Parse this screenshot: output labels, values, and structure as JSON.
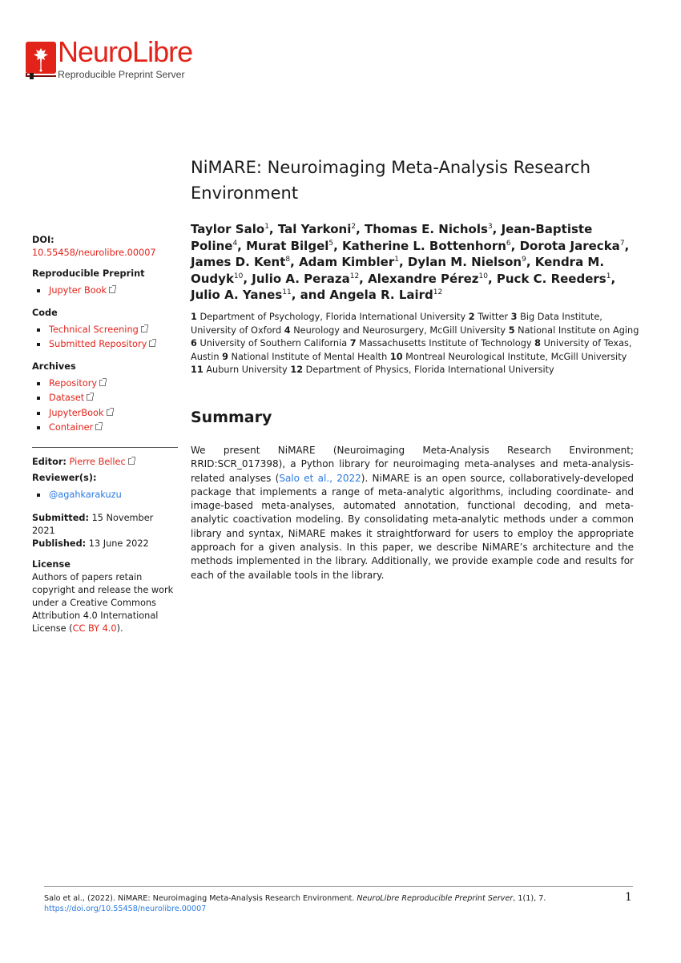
{
  "logo": {
    "name": "NeuroLibre",
    "subtitle": "Reproducible Preprint Server",
    "brand_color": "#e2231a"
  },
  "paper": {
    "title": "NiMARE: Neuroimaging Meta-Analysis Research Environment",
    "authors": [
      {
        "name": "Taylor Salo",
        "aff": "1",
        "sep": ", "
      },
      {
        "name": "Tal Yarkoni",
        "aff": "2",
        "sep": ", "
      },
      {
        "name": "Thomas E. Nichols",
        "aff": "3",
        "sep": ", "
      },
      {
        "name": "Jean-Baptiste Poline",
        "aff": "4",
        "sep": ", "
      },
      {
        "name": "Murat Bilgel",
        "aff": "5",
        "sep": ", "
      },
      {
        "name": "Katherine L. Bottenhorn",
        "aff": "6",
        "sep": ", "
      },
      {
        "name": "Dorota Jarecka",
        "aff": "7",
        "sep": ", "
      },
      {
        "name": "James D. Kent",
        "aff": "8",
        "sep": ", "
      },
      {
        "name": "Adam Kimbler",
        "aff": "1",
        "sep": ", "
      },
      {
        "name": "Dylan M. Nielson",
        "aff": "9",
        "sep": ", "
      },
      {
        "name": "Kendra M. Oudyk",
        "aff": "10",
        "sep": ", "
      },
      {
        "name": "Julio A. Peraza",
        "aff": "12",
        "sep": ", "
      },
      {
        "name": "Alexandre Pérez",
        "aff": "10",
        "sep": ", "
      },
      {
        "name": "Puck C. Reeders",
        "aff": "1",
        "sep": ", "
      },
      {
        "name": "Julio A. Yanes",
        "aff": "11",
        "sep": ", and "
      },
      {
        "name": "Angela R. Laird",
        "aff": "12",
        "sep": ""
      }
    ],
    "affiliations": [
      {
        "num": "1",
        "text": "Department of Psychology, Florida International University"
      },
      {
        "num": "2",
        "text": "Twitter"
      },
      {
        "num": "3",
        "text": "Big Data Institute, University of Oxford"
      },
      {
        "num": "4",
        "text": "Neurology and Neurosurgery, McGill University"
      },
      {
        "num": "5",
        "text": "National Institute on Aging"
      },
      {
        "num": "6",
        "text": "University of Southern California"
      },
      {
        "num": "7",
        "text": "Massachusetts Institute of Technology"
      },
      {
        "num": "8",
        "text": "University of Texas, Austin"
      },
      {
        "num": "9",
        "text": "National Institute of Mental Health"
      },
      {
        "num": "10",
        "text": "Montreal Neurological Institute, McGill University"
      },
      {
        "num": "11",
        "text": "Auburn University"
      },
      {
        "num": "12",
        "text": "Department of Physics, Florida International University"
      }
    ],
    "summary": {
      "heading": "Summary",
      "text_before_cite": "We present NiMARE (Neuroimaging Meta-Analysis Research Environment; RRID:SCR_017398), a Python library for neuroimaging meta-analyses and meta-analysis-related analyses (",
      "citation": "Salo et al., 2022",
      "text_after_cite": ").  NiMARE is an open source, collaboratively-developed package that implements a range of meta-analytic algorithms, including coordinate- and image-based meta-analyses, automated annotation, functional decoding, and meta-analytic coactivation modeling.  By consolidating meta-analytic methods under a common library and syntax, NiMARE makes it straightforward for users to employ the appropriate approach for a given analysis.  In this paper, we describe NiMARE’s architecture and the methods implemented in the library. Additionally, we provide example code and results for each of the available tools in the library."
    }
  },
  "sidebar": {
    "doi_label": "DOI:",
    "doi_value": "10.55458/neurolibre.00007",
    "preprint_heading": "Reproducible Preprint",
    "preprint_links": [
      "Jupyter Book"
    ],
    "code_heading": "Code",
    "code_links": [
      "Technical Screening",
      "Submitted Repository"
    ],
    "archives_heading": "Archives",
    "archives_links": [
      "Repository",
      "Dataset",
      "JupyterBook",
      "Container"
    ],
    "editor_label": "Editor:",
    "editor_name": "Pierre Bellec",
    "reviewers_heading": "Reviewer(s):",
    "reviewers": [
      "@agahkarakuzu"
    ],
    "submitted_label": "Submitted:",
    "submitted_date": "15 November 2021",
    "published_label": "Published:",
    "published_date": "13 June 2022",
    "license_heading": "License",
    "license_text": "Authors of papers retain copyright and release the work under a Creative Commons Attribution 4.0 International License (",
    "license_link": "CC BY 4.0",
    "license_end": ")."
  },
  "footer": {
    "citation_plain": "Salo et al., (2022).  NiMARE: Neuroimaging Meta-Analysis Research Environment.  ",
    "journal": "NeuroLibre Reproducible Preprint Server",
    "volume": ", 1(1), 7.  ",
    "url": "https://doi.org/10.55458/neurolibre.00007",
    "page_number": "1"
  }
}
